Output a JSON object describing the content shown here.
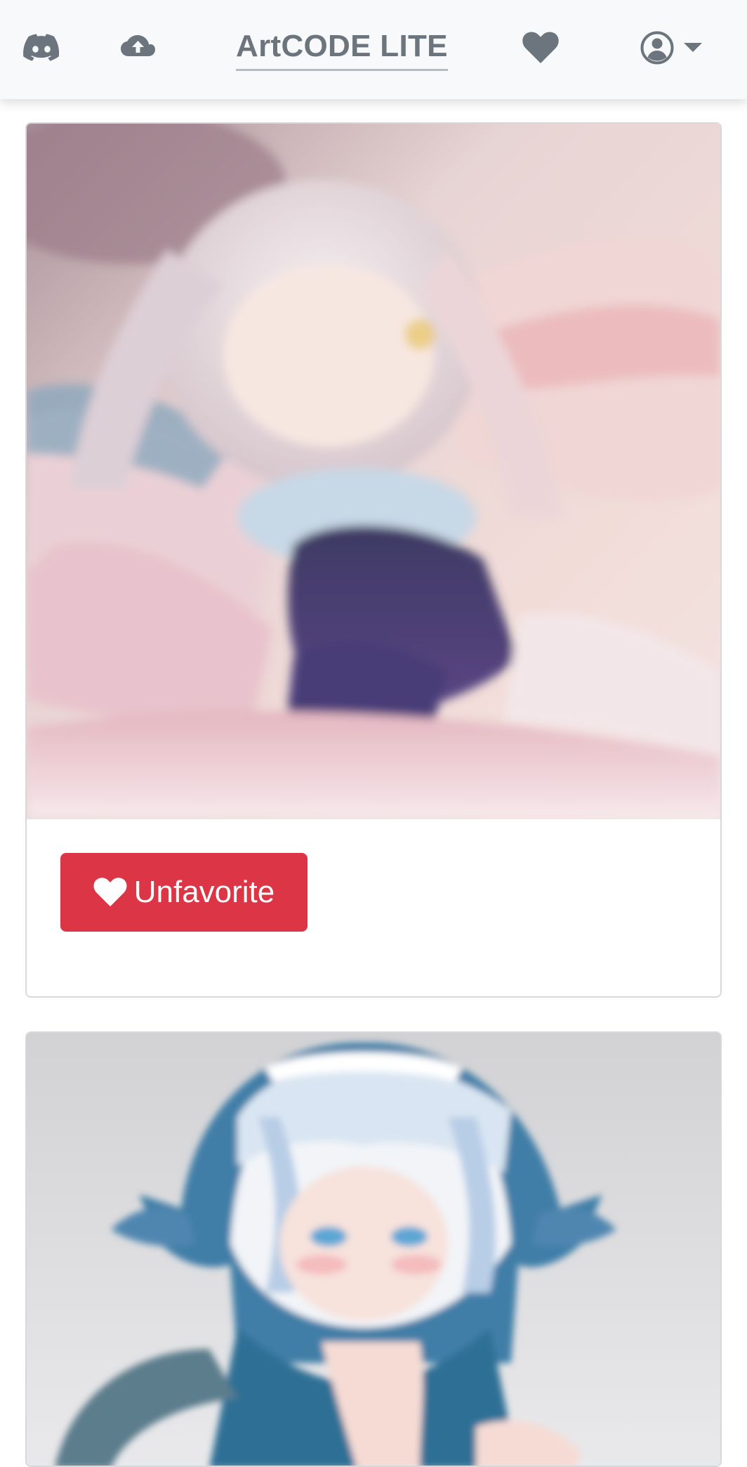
{
  "navbar": {
    "brand": "ArtCODE LITE",
    "icons": {
      "discord": "discord-icon",
      "upload": "cloud-upload-icon",
      "favorites": "heart-icon",
      "account": "user-circle-icon",
      "dropdown": "caret-down-icon"
    }
  },
  "cards": [
    {
      "image_alt": "Artwork: pink-haired anime girl",
      "button_label": "Unfavorite",
      "button_icon": "heart-icon"
    },
    {
      "image_alt": "Artwork: blue shark-hood anime girl",
      "button_label": "",
      "button_icon": "heart-icon"
    }
  ],
  "colors": {
    "navbar_bg": "#f8f9fa",
    "nav_icon": "#6c757d",
    "danger": "#dc3545",
    "card_border": "#d6d8db"
  }
}
